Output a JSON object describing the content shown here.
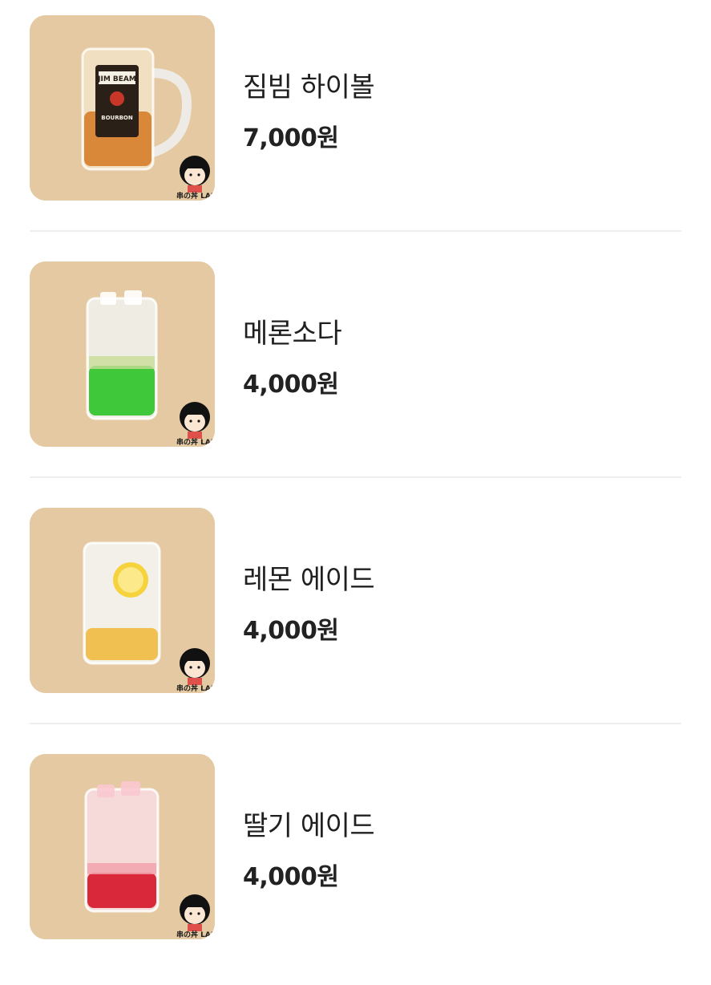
{
  "menu": {
    "items": [
      {
        "name": "짐빔 하이볼",
        "price": "7,000원",
        "image": "jim-beam-highball-mug",
        "drink_color": "#d9883a"
      },
      {
        "name": "메론소다",
        "price": "4,000원",
        "image": "melon-soda-glass",
        "drink_color": "#3ec83a"
      },
      {
        "name": "레몬 에이드",
        "price": "4,000원",
        "image": "lemon-ade-glass",
        "drink_color": "#f0c050"
      },
      {
        "name": "딸기 에이드",
        "price": "4,000원",
        "image": "strawberry-ade-glass",
        "drink_color": "#d8283a"
      }
    ]
  },
  "mascot": {
    "logo_text": "串の丼 LAB",
    "icon": "girl-mascot-icon"
  },
  "photo_label": {
    "bottle_line1": "JIM BEAM",
    "bottle_line2": "BOURBON"
  }
}
